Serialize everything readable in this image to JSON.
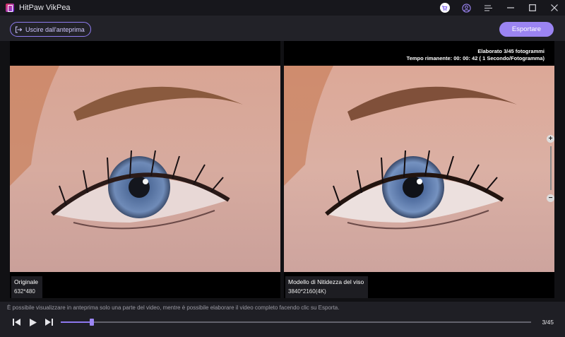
{
  "app": {
    "title": "HitPaw VikPea"
  },
  "toolbar": {
    "exit_label": "Uscire dall'anteprima",
    "export_label": "Esportare"
  },
  "left_panel": {
    "title": "Originale",
    "resolution": "632*480"
  },
  "right_panel": {
    "title": "Modello di Nitidezza del viso",
    "resolution": "3840*2160(4K)",
    "progress_line": "Elaborato 3/45 fotogrammi",
    "remaining_line": "Tempo rimanente: 00: 00: 42 ( 1 Secondo/Fotogramma)"
  },
  "zoom": {
    "plus": "+",
    "minus": "−"
  },
  "notice": "È possibile visualizzare in anteprima solo una parte del video, mentre è possibile elaborare il video completo facendo clic su Esporta.",
  "playback": {
    "current_frame": 3,
    "total_frames": 45,
    "counter": "3/45"
  },
  "colors": {
    "accent": "#9b84f2",
    "background": "#111114",
    "toolbar": "#222228"
  }
}
